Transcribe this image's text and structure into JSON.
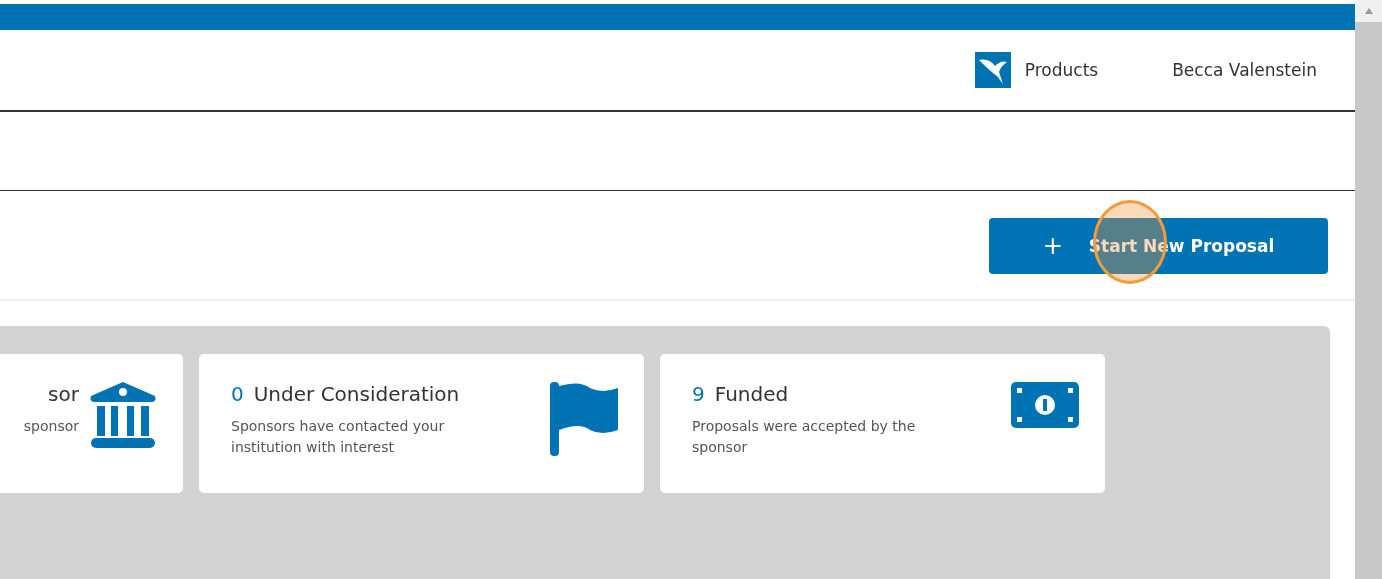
{
  "header": {
    "products_label": "Products",
    "user_name": "Becca Valenstein"
  },
  "actions": {
    "primary_button": {
      "icon": "+",
      "label": "Start New Proposal"
    }
  },
  "cards": [
    {
      "kind": "bank",
      "title": "sor",
      "description": "sponsor"
    },
    {
      "kind": "flag",
      "count": "0",
      "title": "Under Consideration",
      "description": "Sponsors have contacted your institution with interest"
    },
    {
      "kind": "money",
      "count": "9",
      "title": "Funded",
      "description": "Proposals were accepted by the sponsor"
    }
  ]
}
